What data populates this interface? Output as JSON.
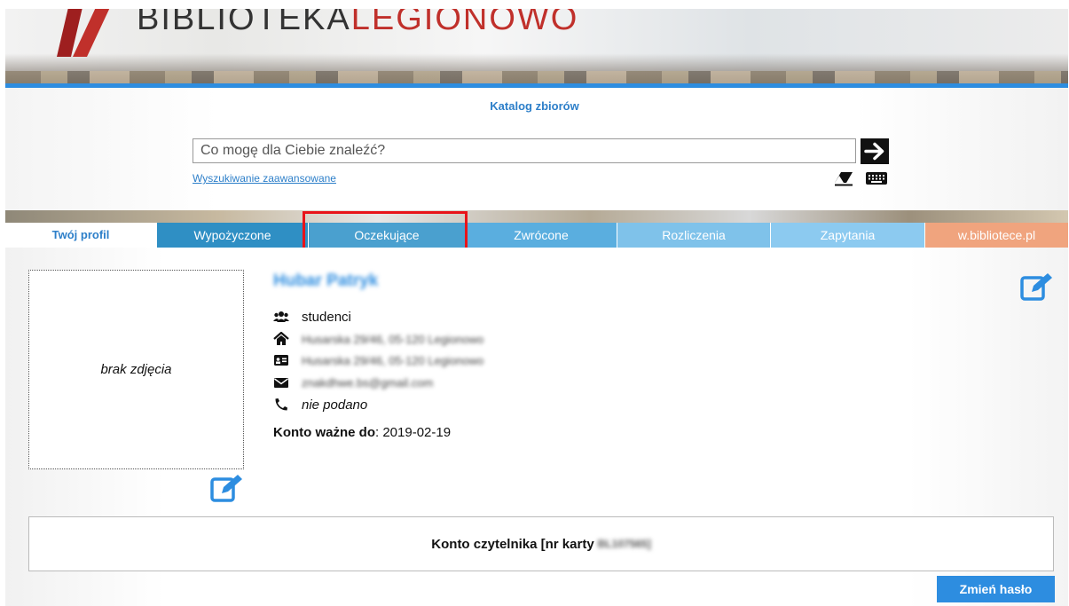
{
  "header": {
    "logo_text_dark": "BIBLIOTEKA",
    "logo_text_red": "LEGIONOWO",
    "catalog_title": "Katalog zbiorów"
  },
  "search": {
    "placeholder": "Co mogę dla Ciebie znaleźć?",
    "advanced_link": "Wyszukiwanie zaawansowane",
    "submit_icon": "arrow-right-icon",
    "clear_icon": "eraser-icon",
    "keyboard_icon": "keyboard-icon"
  },
  "tabs": [
    {
      "label": "Twój profil",
      "color": "#ffffff",
      "active": true
    },
    {
      "label": "Wypożyczone",
      "color": "#2f8fc4"
    },
    {
      "label": "Oczekujące",
      "color": "#4aa0cf"
    },
    {
      "label": "Zwrócone",
      "color": "#5aaedf"
    },
    {
      "label": "Rozliczenia",
      "color": "#7fc2ea"
    },
    {
      "label": "Zapytania",
      "color": "#8ccaf0"
    },
    {
      "label": "w.bibliotece.pl",
      "color": "#f0a47e"
    }
  ],
  "profile": {
    "photo_placeholder": "brak zdjęcia",
    "name": "Hubar Patryk",
    "group": "studenci",
    "address": "Husarska 29/46, 05-120 Legionowo",
    "correspondence_address": "Husarska 29/46, 05-120 Legionowo",
    "email": "znakdhwe.bs@gmail.com",
    "phone": "nie podano",
    "valid_label": "Konto ważne do",
    "valid_until": ": 2019-02-19"
  },
  "account": {
    "label": "Konto czytelnika [nr karty",
    "card_number": "BL107565]",
    "change_password": "Zmień hasło"
  },
  "colors": {
    "accent": "#2d8de0",
    "highlight": "#e8141a",
    "logo_red": "#c0302b"
  }
}
